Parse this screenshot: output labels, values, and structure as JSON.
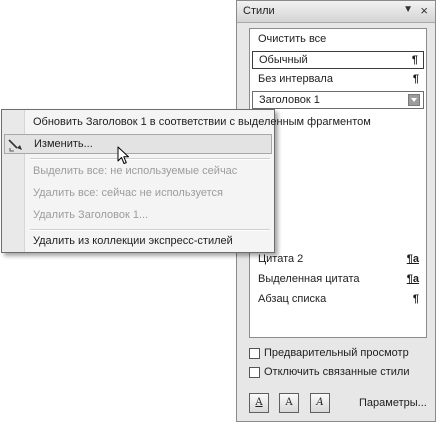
{
  "panel": {
    "title": "Стили",
    "dropdown_glyph": "▼",
    "close_glyph": "×",
    "style_list": [
      {
        "label": "Очистить все",
        "mark": ""
      },
      {
        "label": "Обычный",
        "mark": "¶"
      },
      {
        "label": "Без интервала",
        "mark": "¶"
      },
      {
        "label": "Заголовок 1",
        "mark": ""
      },
      {
        "label": "Цитата 2",
        "mark": "¶a"
      },
      {
        "label": "Выделенная цитата",
        "mark": "¶a"
      },
      {
        "label": "Абзац списка",
        "mark": "¶"
      }
    ],
    "checkboxes": [
      {
        "label": "Предварительный просмотр",
        "checked": false
      },
      {
        "label": "Отключить связанные стили",
        "checked": false
      }
    ],
    "buttons": [
      {
        "icon": "new-style-icon",
        "glyph": "A"
      },
      {
        "icon": "style-inspector-icon",
        "glyph": "A"
      },
      {
        "icon": "manage-styles-icon",
        "glyph": "A"
      }
    ],
    "params_label": "Параметры..."
  },
  "context_menu": {
    "items": [
      {
        "text": "Обновить Заголовок 1 в соответствии с выделенным фрагментом",
        "enabled": true
      },
      {
        "text": "Изменить...",
        "enabled": true,
        "icon": "edit-style-icon",
        "hover": true
      },
      {
        "text": "Выделить все: не используемые сейчас",
        "enabled": false
      },
      {
        "text": "Удалить все: сейчас не используется",
        "enabled": false
      },
      {
        "text": "Удалить Заголовок 1...",
        "enabled": false
      },
      {
        "text": "Удалить из коллекции экспресс-стилей",
        "enabled": true
      }
    ]
  },
  "colors": {
    "panel_bg": "#e7e7e7",
    "menu_bg": "#f4f4f4",
    "disabled_text": "#9c9c9c",
    "hover_bg": "#e3e3e3"
  }
}
